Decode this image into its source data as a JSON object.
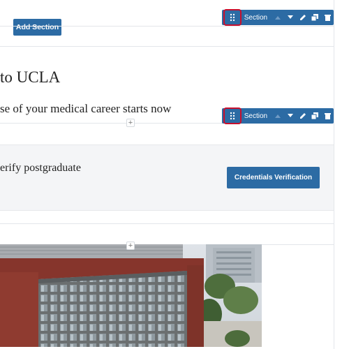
{
  "add_section": {
    "label": "Add Section"
  },
  "toolbars": [
    {
      "label": "Section"
    },
    {
      "label": "Section"
    }
  ],
  "hero": {
    "title": "to UCLA",
    "subtitle": "se of your medical career starts now"
  },
  "panel": {
    "text": "erify postgraduate",
    "button_label": "Credentials Verification"
  },
  "icons": {
    "handle": "drag-handle-icon",
    "up": "arrow-up-icon",
    "down": "arrow-down-icon",
    "edit": "pencil-icon",
    "copy": "duplicate-icon",
    "delete": "trash-icon",
    "add": "plus-icon"
  },
  "colors": {
    "primary": "#2c6ba4",
    "highlight": "#c8102e",
    "panel_bg": "#f4f5f7"
  }
}
